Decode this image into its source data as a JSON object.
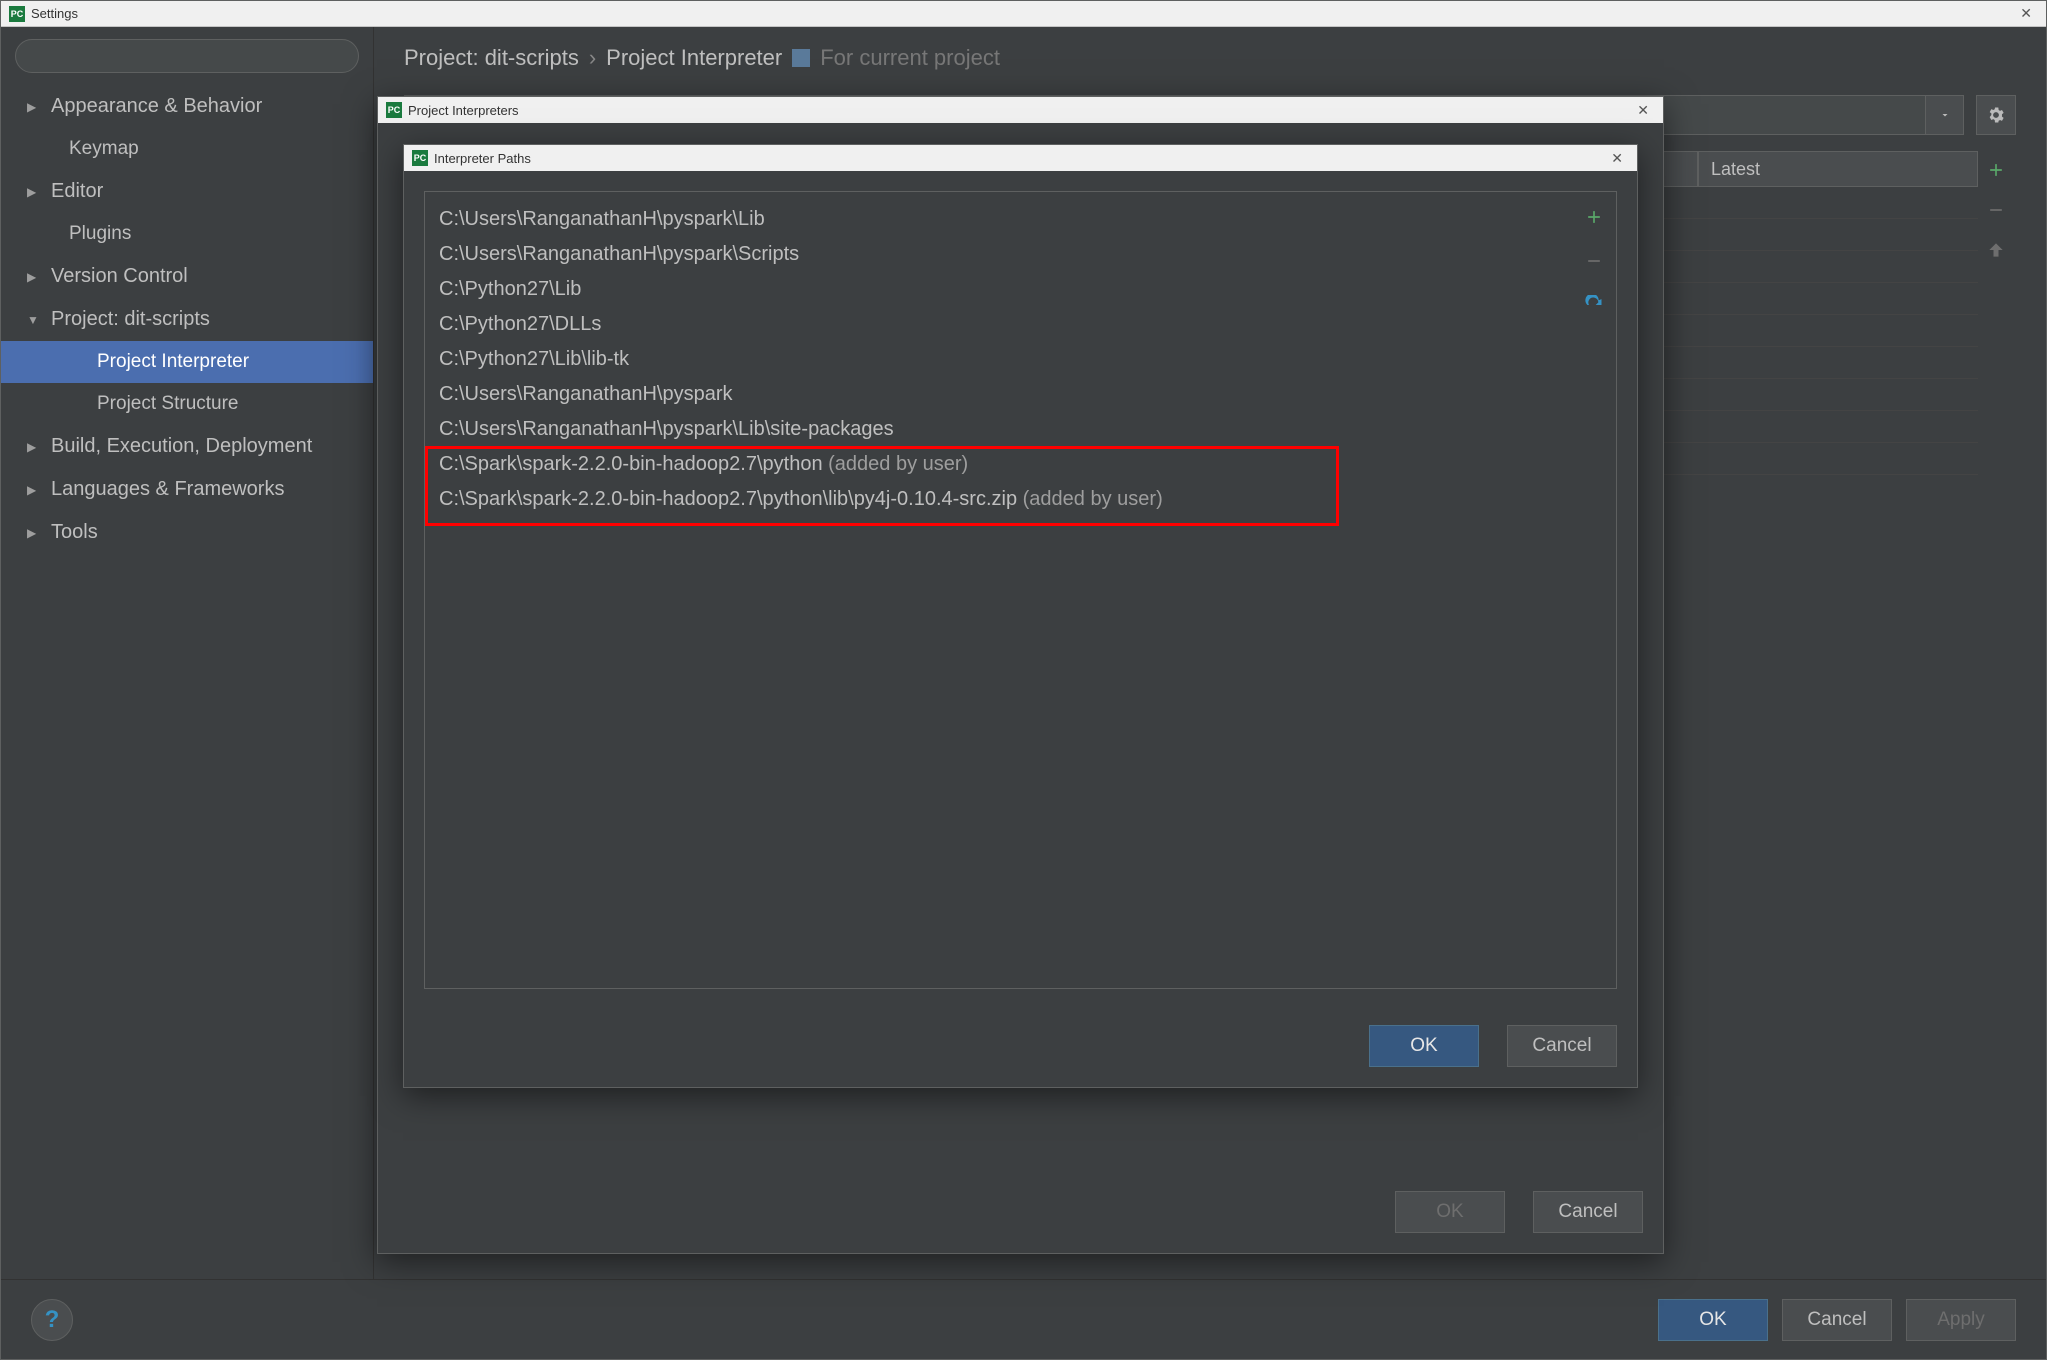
{
  "window": {
    "title": "Settings"
  },
  "sidebar": {
    "search_placeholder": "",
    "items": [
      {
        "label": "Appearance & Behavior",
        "expand": "▶",
        "level": 0
      },
      {
        "label": "Keymap",
        "expand": "",
        "level": 1
      },
      {
        "label": "Editor",
        "expand": "▶",
        "level": 0
      },
      {
        "label": "Plugins",
        "expand": "",
        "level": 1
      },
      {
        "label": "Version Control",
        "expand": "▶",
        "level": 0
      },
      {
        "label": "Project: dit-scripts",
        "expand": "▼",
        "level": 0
      },
      {
        "label": "Project Interpreter",
        "expand": "",
        "level": 2,
        "selected": true
      },
      {
        "label": "Project Structure",
        "expand": "",
        "level": 2
      },
      {
        "label": "Build, Execution, Deployment",
        "expand": "▶",
        "level": 0
      },
      {
        "label": "Languages & Frameworks",
        "expand": "▶",
        "level": 0
      },
      {
        "label": "Tools",
        "expand": "▶",
        "level": 0
      }
    ]
  },
  "breadcrumb": {
    "project": "Project: dit-scripts",
    "sep": "›",
    "page": "Project Interpreter",
    "for_current": "For current project"
  },
  "table": {
    "col_latest": "Latest"
  },
  "buttons": {
    "ok": "OK",
    "cancel": "Cancel",
    "apply": "Apply"
  },
  "dlg_pi": {
    "title": "Project Interpreters"
  },
  "dlg_paths": {
    "title": "Interpreter Paths",
    "paths": [
      {
        "text": "C:\\Users\\RanganathanH\\pyspark\\Lib",
        "added": ""
      },
      {
        "text": "C:\\Users\\RanganathanH\\pyspark\\Scripts",
        "added": ""
      },
      {
        "text": "C:\\Python27\\Lib",
        "added": ""
      },
      {
        "text": "C:\\Python27\\DLLs",
        "added": ""
      },
      {
        "text": "C:\\Python27\\Lib\\lib-tk",
        "added": ""
      },
      {
        "text": "C:\\Users\\RanganathanH\\pyspark",
        "added": ""
      },
      {
        "text": "C:\\Users\\RanganathanH\\pyspark\\Lib\\site-packages",
        "added": ""
      },
      {
        "text": "C:\\Spark\\spark-2.2.0-bin-hadoop2.7\\python",
        "added": "  (added by user)"
      },
      {
        "text": "C:\\Spark\\spark-2.2.0-bin-hadoop2.7\\python\\lib\\py4j-0.10.4-src.zip",
        "added": "  (added by user)"
      }
    ]
  }
}
